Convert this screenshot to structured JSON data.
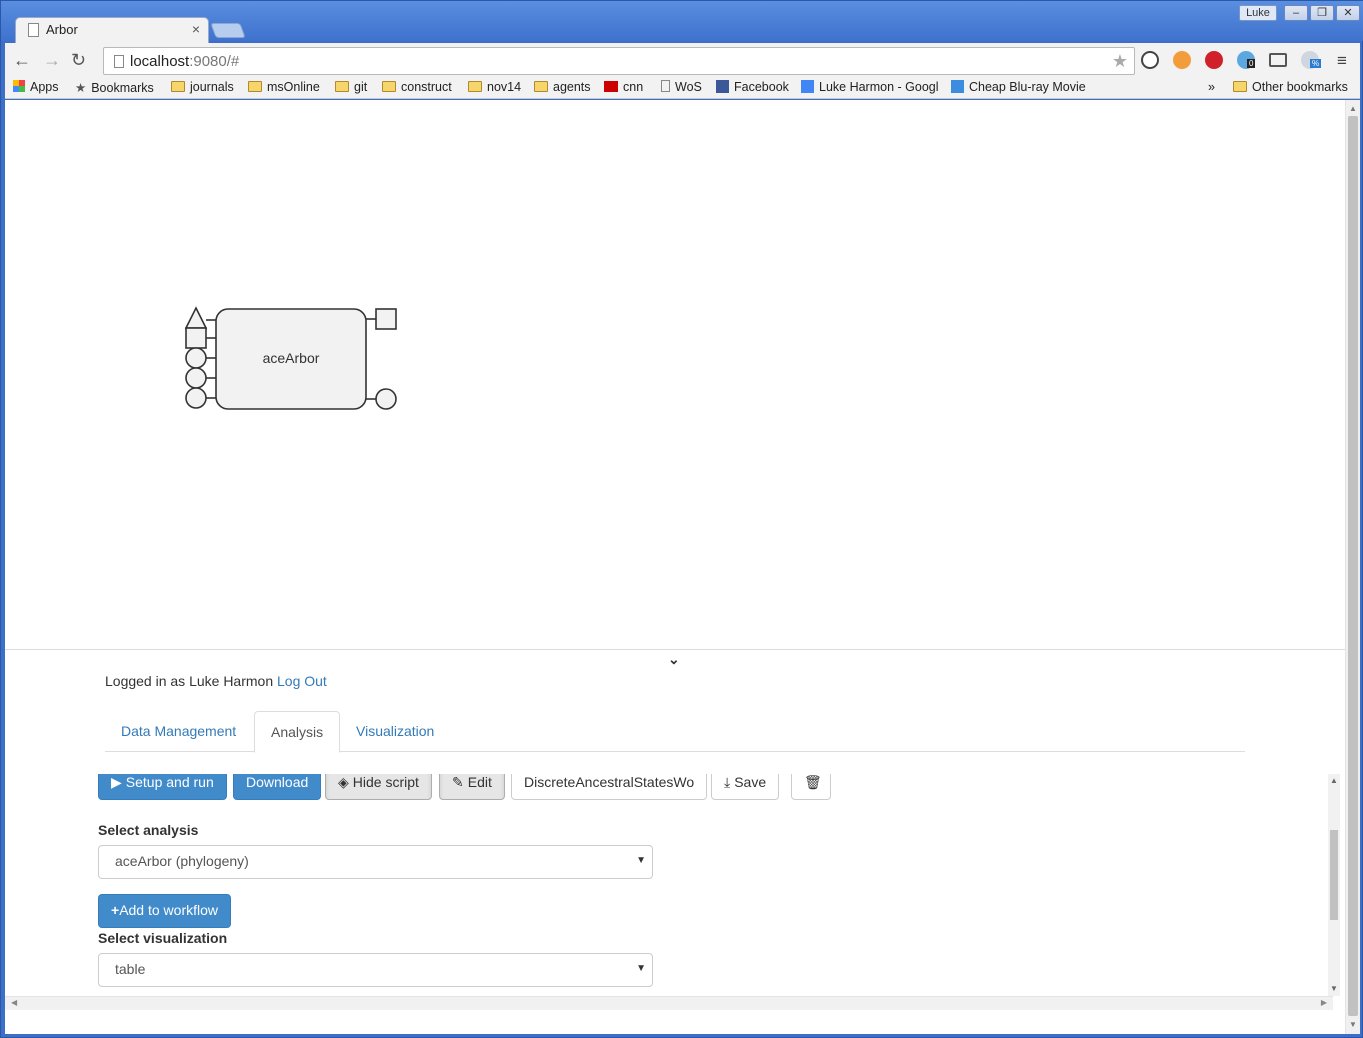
{
  "window": {
    "tab_title": "Arbor",
    "user": "Luke",
    "minimize": "–",
    "maximize": "❐",
    "close": "✕"
  },
  "toolbar": {
    "url_host": "localhost",
    "url_rest": ":9080/#"
  },
  "bookmarks": [
    {
      "label": "Apps"
    },
    {
      "label": "Bookmarks"
    },
    {
      "label": "journals"
    },
    {
      "label": "msOnline"
    },
    {
      "label": "git"
    },
    {
      "label": "construct"
    },
    {
      "label": "nov14"
    },
    {
      "label": "agents"
    },
    {
      "label": "cnn"
    },
    {
      "label": "WoS"
    },
    {
      "label": "Facebook"
    },
    {
      "label": "Luke Harmon - Googl"
    },
    {
      "label": "Cheap Blu-ray Movie"
    },
    {
      "label": "»"
    },
    {
      "label": "Other bookmarks"
    }
  ],
  "extensions": {
    "badge_count": "0",
    "percent_badge": "%"
  },
  "workflow": {
    "node_label": "aceArbor"
  },
  "session": {
    "logged_in_prefix": "Logged in as Luke Harmon",
    "logout_label": "Log Out"
  },
  "tabs": [
    {
      "label": "Data Management",
      "active": false
    },
    {
      "label": "Analysis",
      "active": true
    },
    {
      "label": "Visualization",
      "active": false
    }
  ],
  "actions": {
    "setup_run": "Setup and run",
    "download": "Download",
    "hide_script": "Hide script",
    "edit": "Edit",
    "workflow_name": "DiscreteAncestralStatesWo",
    "save": "Save"
  },
  "form": {
    "analysis_label": "Select analysis",
    "analysis_value": "aceArbor (phylogeny)",
    "add_to_workflow": "Add to workflow",
    "visualization_label": "Select visualization",
    "visualization_value": "table"
  },
  "colors": {
    "primary": "#428bca",
    "link": "#337ab7",
    "chrome_frame": "#3d6fc9"
  }
}
